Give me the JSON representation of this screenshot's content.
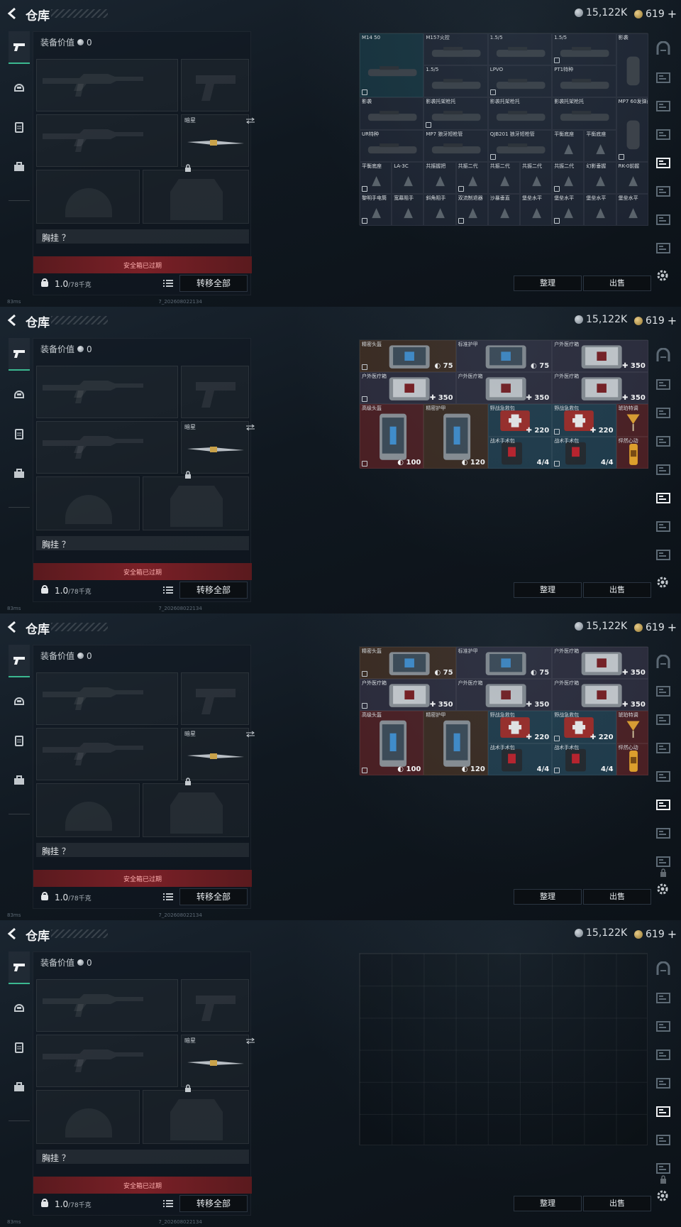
{
  "header": {
    "title": "仓库",
    "silver": "15,122K",
    "gold": "619",
    "gold_plus": "+"
  },
  "loadout": {
    "value_label": "装备价值",
    "value": "0",
    "melee_name": "暗星",
    "chest_label": "胸挂 ？",
    "safebox_label": "安全箱已过期",
    "weight_value": "1.0",
    "weight_max": "/78千克",
    "transfer_label": "转移全部"
  },
  "actions": {
    "sort_label": "整理",
    "sell_label": "出售"
  },
  "status": {
    "ping": "83ms",
    "build": "7_202608022134"
  },
  "panels": [
    {
      "items": [
        {
          "name": "M14 50",
          "c": 0,
          "r": 0,
          "w": 2,
          "h": 2,
          "bg": "#16323d"
        },
        {
          "name": "M157火控",
          "c": 2,
          "r": 0,
          "w": 2,
          "h": 1,
          "bg": "#1d2431"
        },
        {
          "name": "1.5/5",
          "c": 4,
          "r": 0,
          "w": 2,
          "h": 1,
          "bg": "#1d2431"
        },
        {
          "name": "1.5/5",
          "c": 6,
          "r": 0,
          "w": 2,
          "h": 1,
          "bg": "#1d2431"
        },
        {
          "name": "影袭",
          "c": 8,
          "r": 0,
          "w": 1,
          "h": 2,
          "bg": "#1d2431"
        },
        {
          "name": "1.5/5",
          "c": 2,
          "r": 1,
          "w": 2,
          "h": 1,
          "bg": "#1d2431"
        },
        {
          "name": "LPVO",
          "c": 4,
          "r": 1,
          "w": 2,
          "h": 1,
          "bg": "#1d2431"
        },
        {
          "name": "PT1特种",
          "c": 6,
          "r": 1,
          "w": 2,
          "h": 1,
          "bg": "#1d2431"
        },
        {
          "name": "影袭",
          "c": 0,
          "r": 2,
          "w": 2,
          "h": 1,
          "bg": "#1d2431"
        },
        {
          "name": "影袭托架枪托",
          "c": 2,
          "r": 2,
          "w": 2,
          "h": 1,
          "bg": "#1d2431"
        },
        {
          "name": "影袭托架枪托",
          "c": 4,
          "r": 2,
          "w": 2,
          "h": 1,
          "bg": "#1d2431"
        },
        {
          "name": "影袭托架枪托",
          "c": 6,
          "r": 2,
          "w": 2,
          "h": 1,
          "bg": "#1d2431"
        },
        {
          "name": "MP7 60发弹鼓",
          "c": 8,
          "r": 2,
          "w": 1,
          "h": 2,
          "bg": "#1d2431"
        },
        {
          "name": "UR特种",
          "c": 0,
          "r": 3,
          "w": 2,
          "h": 1,
          "bg": "#1d2431"
        },
        {
          "name": "MP7 狼牙短枪管",
          "c": 2,
          "r": 3,
          "w": 2,
          "h": 1,
          "bg": "#1d2431"
        },
        {
          "name": "QJB201 狼牙短枪管",
          "c": 4,
          "r": 3,
          "w": 2,
          "h": 1,
          "bg": "#1d2431"
        },
        {
          "name": "平衡底座",
          "c": 6,
          "r": 3,
          "w": 1,
          "h": 1,
          "bg": "#1d2431"
        },
        {
          "name": "平衡底座",
          "c": 7,
          "r": 3,
          "w": 1,
          "h": 1,
          "bg": "#1d2431"
        },
        {
          "name": "平衡底座",
          "c": 0,
          "r": 4,
          "w": 1,
          "h": 1,
          "bg": "#1d2431"
        },
        {
          "name": "LA-3C",
          "c": 1,
          "r": 4,
          "w": 1,
          "h": 1,
          "bg": "#1d2431"
        },
        {
          "name": "共振握把",
          "c": 2,
          "r": 4,
          "w": 1,
          "h": 1,
          "bg": "#1d2431"
        },
        {
          "name": "共振二代",
          "c": 3,
          "r": 4,
          "w": 1,
          "h": 1,
          "bg": "#1d2431"
        },
        {
          "name": "共振二代",
          "c": 4,
          "r": 4,
          "w": 1,
          "h": 1,
          "bg": "#1d2431"
        },
        {
          "name": "共振二代",
          "c": 5,
          "r": 4,
          "w": 1,
          "h": 1,
          "bg": "#1d2431"
        },
        {
          "name": "共振二代",
          "c": 6,
          "r": 4,
          "w": 1,
          "h": 1,
          "bg": "#1d2431"
        },
        {
          "name": "幻影垂握",
          "c": 7,
          "r": 4,
          "w": 1,
          "h": 1,
          "bg": "#1d2431"
        },
        {
          "name": "RK-0前握",
          "c": 8,
          "r": 4,
          "w": 1,
          "h": 1,
          "bg": "#1d2431"
        },
        {
          "name": "黎明手电筒",
          "c": 0,
          "r": 5,
          "w": 1,
          "h": 1,
          "bg": "#1d2431"
        },
        {
          "name": "宽幕阻手",
          "c": 1,
          "r": 5,
          "w": 1,
          "h": 1,
          "bg": "#1d2431"
        },
        {
          "name": "斜角阻手",
          "c": 2,
          "r": 5,
          "w": 1,
          "h": 1,
          "bg": "#1d2431"
        },
        {
          "name": "双流制退器",
          "c": 3,
          "r": 5,
          "w": 1,
          "h": 1,
          "bg": "#1d2431"
        },
        {
          "name": "沙暴垂直",
          "c": 4,
          "r": 5,
          "w": 1,
          "h": 1,
          "bg": "#1d2431"
        },
        {
          "name": "堡垒水平",
          "c": 5,
          "r": 5,
          "w": 1,
          "h": 1,
          "bg": "#1d2431"
        },
        {
          "name": "堡垒水平",
          "c": 6,
          "r": 5,
          "w": 1,
          "h": 1,
          "bg": "#1d2431"
        },
        {
          "name": "堡垒水平",
          "c": 7,
          "r": 5,
          "w": 1,
          "h": 1,
          "bg": "#1d2431"
        },
        {
          "name": "堡垒水平",
          "c": 8,
          "r": 5,
          "w": 1,
          "h": 1,
          "bg": "#1d2431"
        }
      ]
    },
    {
      "items": [
        {
          "name": "精密头盔",
          "c": 0,
          "r": 0,
          "w": 3,
          "h": 1,
          "bg": "#3a2a20",
          "val": "75",
          "kind": "armor",
          "sym": "shield"
        },
        {
          "name": "标准护甲",
          "c": 3,
          "r": 0,
          "w": 3,
          "h": 1,
          "bg": "#2a2a3a",
          "val": "75",
          "kind": "armor",
          "sym": "shield"
        },
        {
          "name": "户外医疗箱",
          "c": 6,
          "r": 0,
          "w": 3,
          "h": 1,
          "bg": "#2a2a3a",
          "val": "350",
          "kind": "med",
          "sym": "plus"
        },
        {
          "name": "户外医疗箱",
          "c": 0,
          "r": 1,
          "w": 3,
          "h": 1,
          "bg": "#2a2a3a",
          "val": "350",
          "kind": "med",
          "sym": "plus"
        },
        {
          "name": "户外医疗箱",
          "c": 3,
          "r": 1,
          "w": 3,
          "h": 1,
          "bg": "#2a2a3a",
          "val": "350",
          "kind": "med",
          "sym": "plus"
        },
        {
          "name": "户外医疗箱",
          "c": 6,
          "r": 1,
          "w": 3,
          "h": 1,
          "bg": "#2a2a3a",
          "val": "350",
          "kind": "med",
          "sym": "plus"
        },
        {
          "name": "高级头盔",
          "c": 0,
          "r": 2,
          "w": 2,
          "h": 2,
          "bg": "#4a1e22",
          "val": "100",
          "kind": "armor",
          "sym": "shield"
        },
        {
          "name": "精密护甲",
          "c": 2,
          "r": 2,
          "w": 2,
          "h": 2,
          "bg": "#3a2a20",
          "val": "120",
          "kind": "armor",
          "sym": "shield"
        },
        {
          "name": "野战急救包",
          "c": 4,
          "r": 2,
          "w": 2,
          "h": 1,
          "bg": "#1e3a4a",
          "val": "220",
          "kind": "redkit",
          "sym": "plus"
        },
        {
          "name": "野战急救包",
          "c": 6,
          "r": 2,
          "w": 2,
          "h": 1,
          "bg": "#1e3a4a",
          "val": "220",
          "kind": "redkit",
          "sym": "plus"
        },
        {
          "name": "琥珀特调",
          "c": 8,
          "r": 2,
          "w": 1,
          "h": 1,
          "bg": "#4a1e22",
          "kind": "drink"
        },
        {
          "name": "战术手术包",
          "c": 4,
          "r": 3,
          "w": 2,
          "h": 1,
          "bg": "#1e3a4a",
          "val": "4/4",
          "kind": "pouch"
        },
        {
          "name": "战术手术包",
          "c": 6,
          "r": 3,
          "w": 2,
          "h": 1,
          "bg": "#1e3a4a",
          "val": "4/4",
          "kind": "pouch"
        },
        {
          "name": "怦然心动",
          "c": 8,
          "r": 3,
          "w": 1,
          "h": 1,
          "bg": "#4a1e22",
          "kind": "can"
        }
      ]
    }
  ],
  "panel_configs": [
    {
      "inv": 0,
      "rows": 6
    },
    {
      "inv": 1,
      "rows": 4
    },
    {
      "inv": 1,
      "rows": 4
    },
    {
      "inv": -1,
      "rows": 6
    }
  ]
}
